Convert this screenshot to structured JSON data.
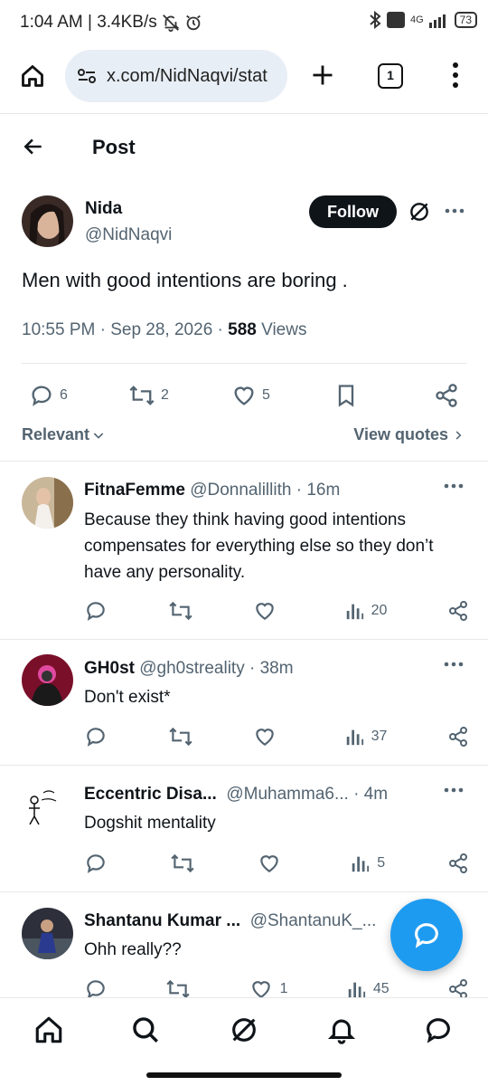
{
  "status_bar": {
    "time_speed": "1:04 AM | 3.4KB/s",
    "network": "4G",
    "battery": "73"
  },
  "browser": {
    "url": "x.com/NidNaqvi/stat",
    "tab_count": "1"
  },
  "header": {
    "title": "Post"
  },
  "post": {
    "author_name": "Nida",
    "author_handle": "@NidNaqvi",
    "follow_label": "Follow",
    "text": "Men with good intentions are boring .",
    "meta_time": "10:55 PM · Sep 28, 2026 · ",
    "views_count": "588",
    "views_label": " Views",
    "replies": "6",
    "reposts": "2",
    "likes": "5",
    "sort_label": "Relevant",
    "view_quotes_label": "View quotes"
  },
  "replies": [
    {
      "name": "FitnaFemme",
      "handle": "@Donnalillith",
      "time": " · 16m",
      "text": "Because they think having good intentions compensates for everything else so they don’t have any personality.",
      "likes": "",
      "views": "20"
    },
    {
      "name": "GH0st",
      "handle": "@gh0streality",
      "time": " · 38m",
      "text": "Don't exist*",
      "likes": "",
      "views": "37"
    },
    {
      "name": "Eccentric Disa...",
      "handle": "@Muhamma6...",
      "time": " · 4m",
      "text": "Dogshit mentality",
      "likes": "",
      "views": "5"
    },
    {
      "name": "Shantanu Kumar ...",
      "handle": "@ShantanuK_...",
      "time": "",
      "text": "Ohh really??",
      "likes": "1",
      "views": "45"
    }
  ],
  "colors": {
    "accent": "#1d9bf0",
    "text": "#0f1419",
    "secondary": "#536471",
    "url_bg": "#e8eef6"
  }
}
